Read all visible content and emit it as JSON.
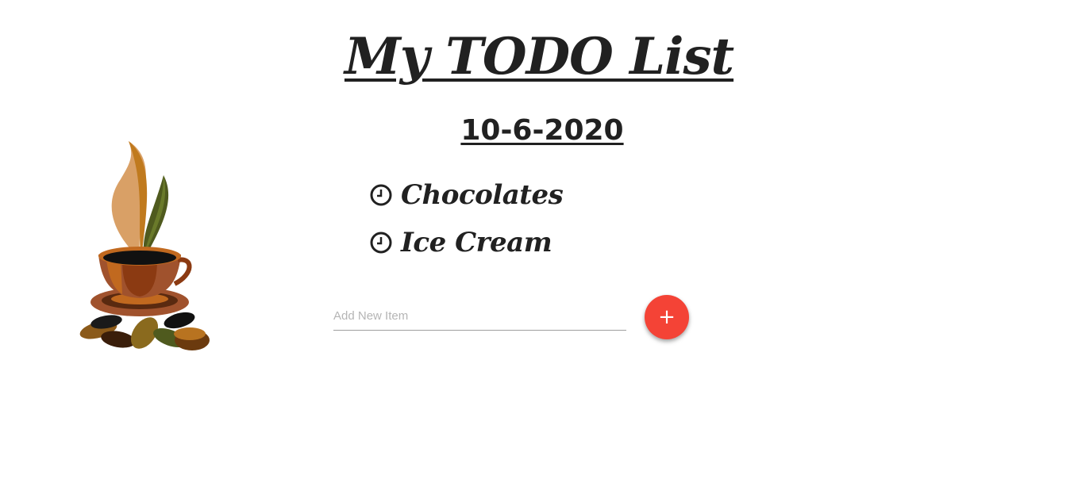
{
  "header": {
    "title": "My TODO List",
    "date": "10-6-2020"
  },
  "todos": [
    {
      "label": "Chocolates",
      "icon": "clock-icon"
    },
    {
      "label": "Ice Cream",
      "icon": "clock-icon"
    }
  ],
  "add_form": {
    "placeholder": "Add New Item",
    "value": "",
    "button_label": "+"
  },
  "colors": {
    "accent": "#f44336",
    "text": "#212121",
    "underline": "#9e9e9e"
  },
  "decoration": {
    "image": "coffee-cup-illustration"
  }
}
